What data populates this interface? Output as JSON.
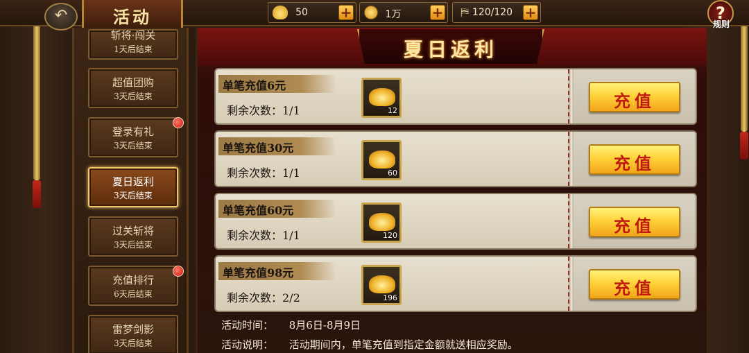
{
  "topbar": {
    "title": "活动",
    "resources": [
      {
        "icon": "gold-ingot-icon",
        "value": "50"
      },
      {
        "icon": "coin-icon",
        "value": "1万"
      },
      {
        "icon": "banner-icon",
        "value": "120/120"
      }
    ],
    "rules_label": "规则"
  },
  "sidebar": {
    "items": [
      {
        "name": "斩将·闯关",
        "duration": "1天后结束",
        "active": false,
        "dot": false
      },
      {
        "name": "超值团购",
        "duration": "3天后结束",
        "active": false,
        "dot": false
      },
      {
        "name": "登录有礼",
        "duration": "3天后结束",
        "active": false,
        "dot": true
      },
      {
        "name": "夏日返利",
        "duration": "3天后结束",
        "active": true,
        "dot": false
      },
      {
        "name": "过关斩将",
        "duration": "3天后结束",
        "active": false,
        "dot": false
      },
      {
        "name": "充值排行",
        "duration": "6天后结束",
        "active": false,
        "dot": true
      },
      {
        "name": "雷梦剑影",
        "duration": "3天后结束",
        "active": false,
        "dot": false
      }
    ]
  },
  "main": {
    "title": "夏日返利",
    "rows": [
      {
        "label": "单笔充值6元",
        "remain": "剩余次数：1/1",
        "reward_qty": "12",
        "button": "充值"
      },
      {
        "label": "单笔充值30元",
        "remain": "剩余次数：1/1",
        "reward_qty": "60",
        "button": "充值"
      },
      {
        "label": "单笔充值60元",
        "remain": "剩余次数：1/1",
        "reward_qty": "120",
        "button": "充值"
      },
      {
        "label": "单笔充值98元",
        "remain": "剩余次数：2/2",
        "reward_qty": "196",
        "button": "充值"
      }
    ],
    "event_time_label": "活动时间：",
    "event_time": "8月6日-8月9日",
    "event_desc_label": "活动说明：",
    "event_desc": "活动期间内，单笔充值到指定金额就送相应奖励。"
  },
  "colors": {
    "accent_gold": "#f2c66a",
    "button_text_red": "#c01b10",
    "panel_red": "#7a1410"
  }
}
